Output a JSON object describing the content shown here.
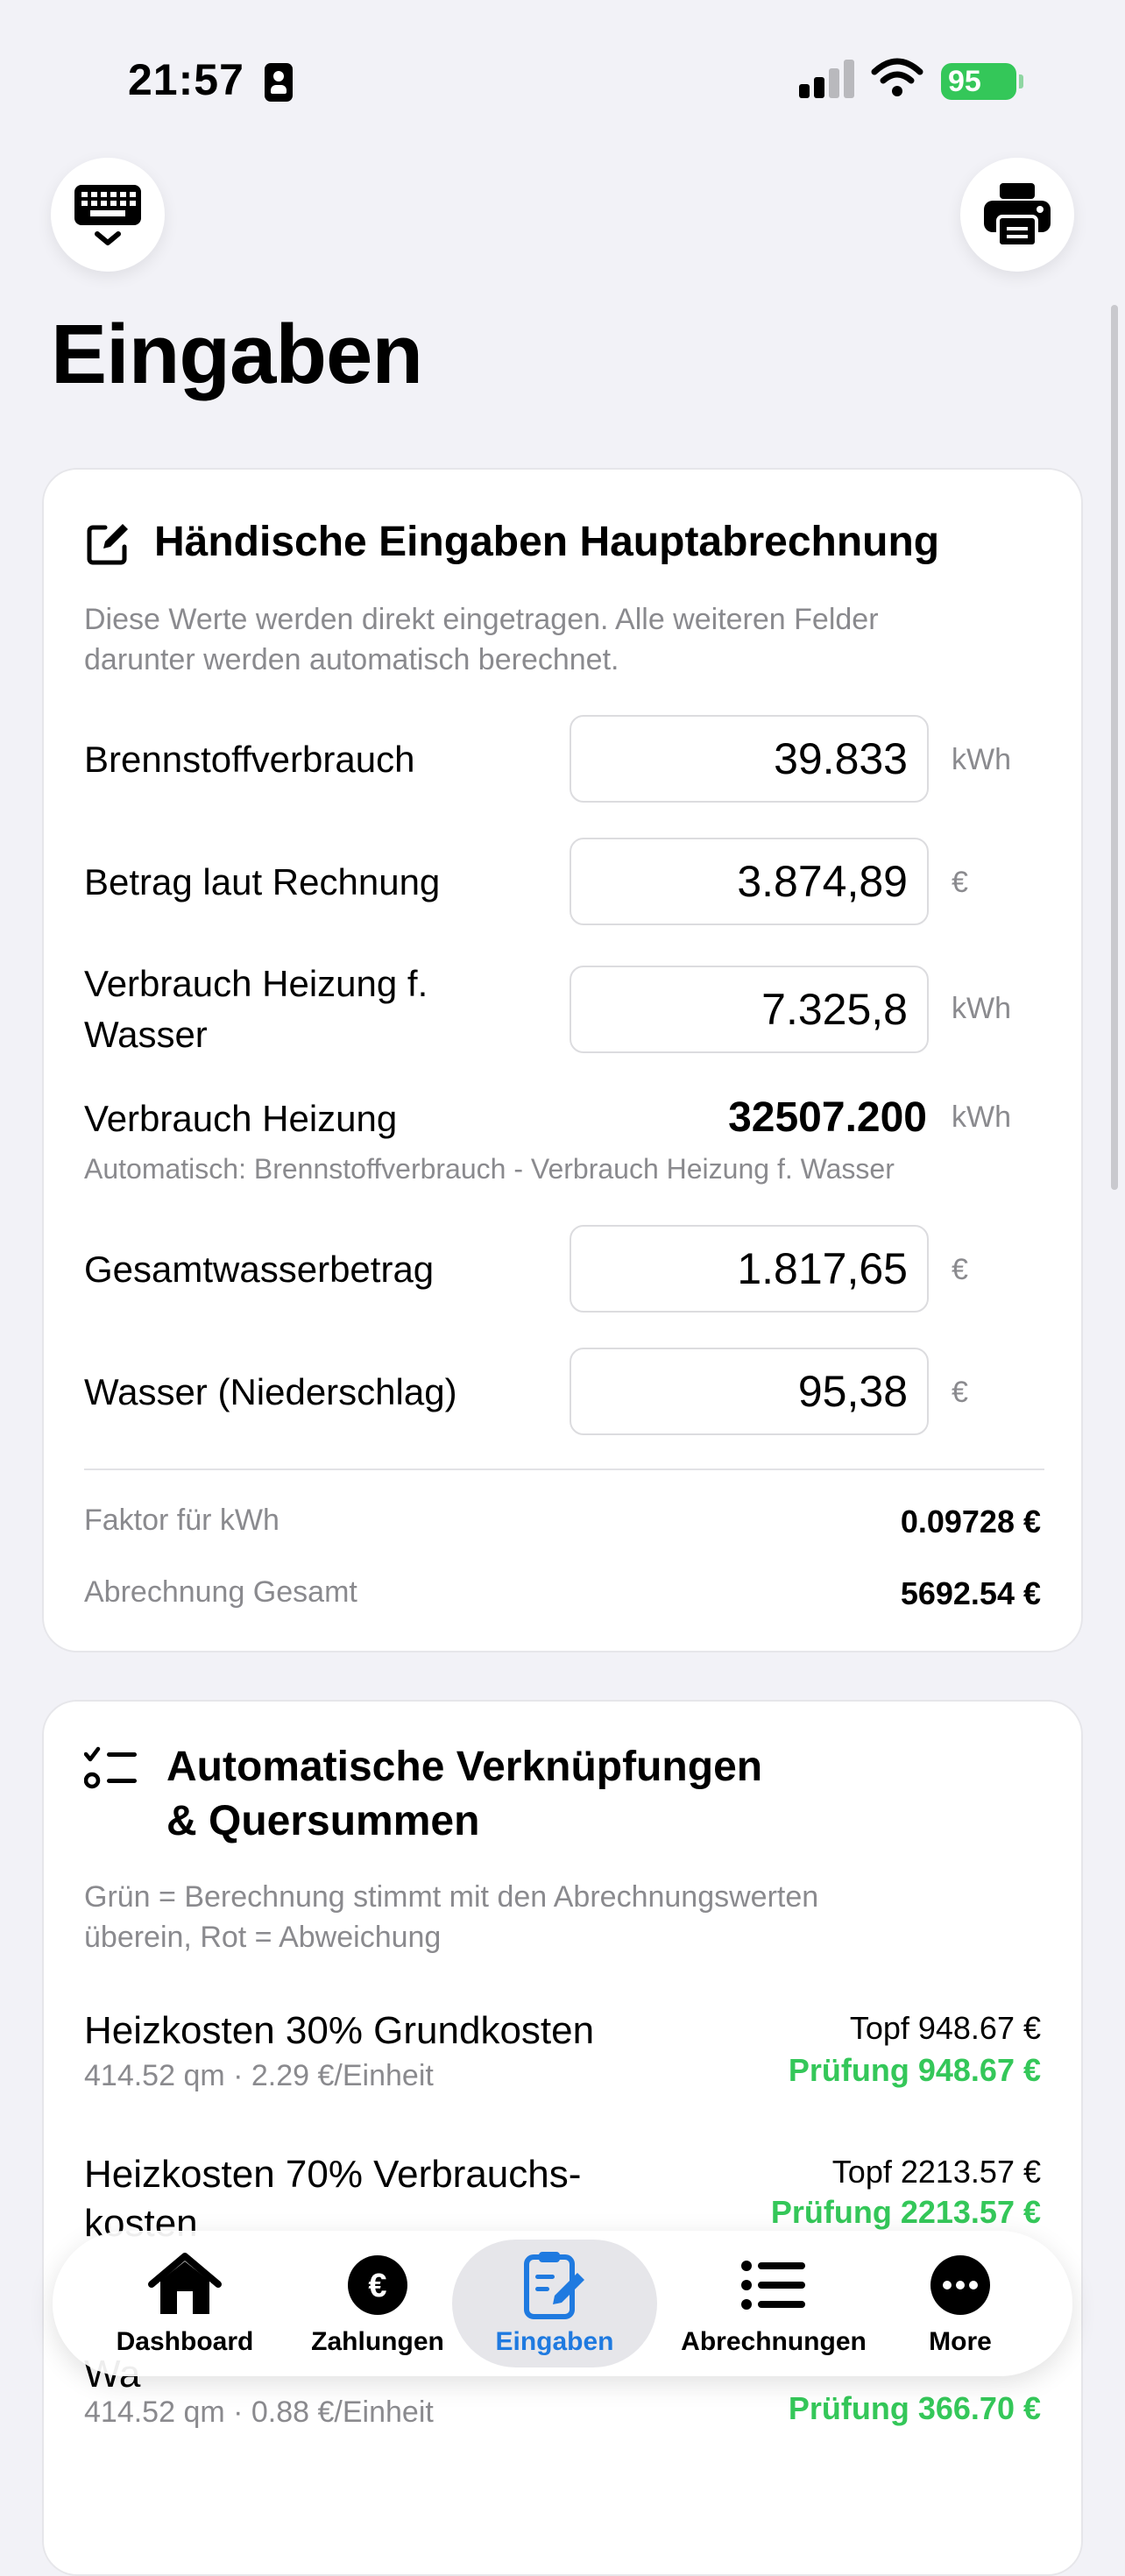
{
  "status_bar": {
    "time": "21:57",
    "battery": "95"
  },
  "header": {
    "keyboard_icon": "keyboard-dismiss-icon",
    "print_icon": "printer-icon",
    "title": "Eingaben"
  },
  "card_manual": {
    "title": "Händische Eingaben Hauptabrechnung",
    "description_line1": "Diese Werte werden direkt eingetragen. Alle weiteren Felder",
    "description_line2": "darunter werden automatisch berechnet.",
    "fields": [
      {
        "label": "Brennstoffverbrauch",
        "value": "39.833",
        "unit": "kWh"
      },
      {
        "label": "Betrag laut Rechnung",
        "value": "3.874,89",
        "unit": "€"
      },
      {
        "label_line1": "Verbrauch Heizung f.",
        "label_line2": "Wasser",
        "value": "7.325,8",
        "unit": "kWh"
      },
      {
        "label": "Gesamtwasserbetrag",
        "value": "1.817,65",
        "unit": "€"
      },
      {
        "label": "Wasser (Niederschlag)",
        "value": "95,38",
        "unit": "€"
      }
    ],
    "computed": {
      "label": "Verbrauch Heizung",
      "value": "32507.200",
      "unit": "kWh",
      "note": "Automatisch: Brennstoffverbrauch - Verbrauch Heizung f. Wasser"
    },
    "summary": [
      {
        "label": "Faktor für kWh",
        "value": "0.09728 €"
      },
      {
        "label": "Abrechnung Gesamt",
        "value": "5692.54 €"
      }
    ]
  },
  "card_links": {
    "title_line1": "Automatische Verknüpfungen",
    "title_line2": "& Quersummen",
    "description_line1": "Grün = Berechnung stimmt mit den Abrechnungswerten",
    "description_line2": "überein, Rot = Abweichung",
    "items": [
      {
        "title": "Heizkosten 30% Grundkosten",
        "sub": "414.52 qm · 2.29 €/Einheit",
        "topf": "Topf 948.67 €",
        "check": "Prüfung 948.67 €"
      },
      {
        "title_line1": "Heizkosten 70% Verbrauchs-",
        "title_line2": "kosten",
        "topf": "Topf 2213.57 €",
        "check": "Prüfung 2213.57 €"
      },
      {
        "title": "Wa",
        "sub": "414.52 qm · 0.88 €/Einheit",
        "check": "Prüfung 366.70 €"
      }
    ]
  },
  "tabbar": {
    "tabs": [
      {
        "label": "Dashboard",
        "icon": "house-icon"
      },
      {
        "label": "Zahlungen",
        "icon": "euro-circle-icon"
      },
      {
        "label": "Eingaben",
        "icon": "clipboard-edit-icon",
        "active": true
      },
      {
        "label": "Abrechnungen",
        "icon": "list-icon"
      },
      {
        "label": "More",
        "icon": "more-circle-icon"
      }
    ],
    "active_color": "#1f7ae0"
  },
  "colors": {
    "success": "#34c759",
    "accent": "#1f7ae0",
    "secondary_text": "#8a8a8e"
  }
}
